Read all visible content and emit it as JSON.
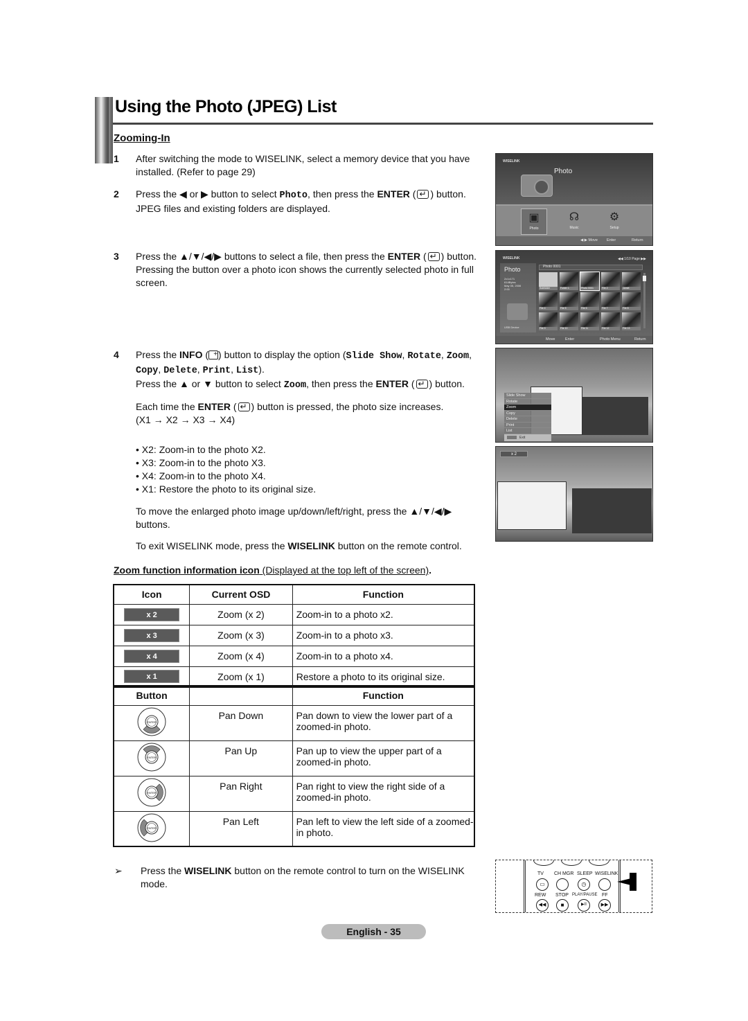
{
  "header": {
    "title": "Using the Photo (JPEG) List",
    "section": "Zooming-In"
  },
  "steps": [
    {
      "num": "1",
      "text": "After switching the mode to WISELINK, select a memory device that you have installed. (Refer to page 29)"
    },
    {
      "num": "2",
      "pre": "Press the ◀ or ▶ button to select ",
      "code": "Photo",
      "mid": ", then press the ",
      "bold": "ENTER",
      "post": " button. JPEG files and existing folders are displayed."
    },
    {
      "num": "3",
      "pre": "Press the ▲/▼/◀/▶ buttons to select a file, then press the ",
      "bold": "ENTER",
      "post": " button.",
      "extra": "Pressing the button over a photo icon shows the currently selected photo in full screen."
    },
    {
      "num": "4",
      "pre": "Press the ",
      "bold": "INFO",
      "mid": " button to display the option (",
      "options": [
        "Slide Show",
        "Rotate",
        "Zoom",
        "Copy",
        "Delete",
        "Print",
        "List"
      ],
      "post": ").",
      "line2_pre": "Press the ▲ or ▼ button to select ",
      "line2_code": "Zoom",
      "line2_mid": ", then press the ",
      "line2_bold": "ENTER",
      "line2_post": " button.",
      "line3_pre": "Each time the ",
      "line3_bold": "ENTER",
      "line3_post": " button is pressed, the photo size increases.",
      "line4": "(X1 → X2 →  X3 → X4)"
    }
  ],
  "bullets": [
    "• X2: Zoom-in to the photo X2.",
    "• X3: Zoom-in to the photo X3.",
    "• X4: Zoom-in to the photo X4.",
    "• X1: Restore the photo to its original size."
  ],
  "move_text": "To move the enlarged photo image up/down/left/right, press the ▲/▼/◀/▶ buttons.",
  "exit_text": {
    "pre": "To exit WISELINK mode, press the ",
    "bold": "WISELINK",
    "post": " button on the remote control."
  },
  "zoom_info": {
    "heading": "Zoom function information icon",
    "sub": " (Displayed at the top left of the screen)",
    "end": "."
  },
  "zoom_table": {
    "headers": [
      "Icon",
      "Current OSD",
      "Function"
    ],
    "rows": [
      {
        "icon": "x 2",
        "osd": "Zoom (x 2)",
        "function": "Zoom-in to a photo x2."
      },
      {
        "icon": "x 3",
        "osd": "Zoom (x 3)",
        "function": "Zoom-in to a photo x3."
      },
      {
        "icon": "x 4",
        "osd": "Zoom (x 4)",
        "function": "Zoom-in to a photo x4."
      },
      {
        "icon": "x 1",
        "osd": "Zoom (x 1)",
        "function": "Restore a photo to its original size."
      }
    ]
  },
  "pan_table": {
    "headers": [
      "Button",
      "",
      "Function"
    ],
    "rows": [
      {
        "highlight": "down",
        "action": "Pan Down",
        "function": "Pan down to view the lower part of a zoomed-in photo."
      },
      {
        "highlight": "up",
        "action": "Pan Up",
        "function": "Pan up to view the upper part of a zoomed-in photo."
      },
      {
        "highlight": "right",
        "action": "Pan Right",
        "function": "Pan right to view the right side of a zoomed-in photo."
      },
      {
        "highlight": "left",
        "action": "Pan Left",
        "function": "Pan left to view the left side of a zoomed-in photo."
      }
    ]
  },
  "note": {
    "arrow": "➢",
    "pre": "Press the ",
    "bold": "WISELINK",
    "post": " button on the remote control to turn on the WISELINK mode."
  },
  "footer": {
    "page": "English - 35"
  },
  "screens": {
    "s1": {
      "logo": "WISELINK",
      "title": "Photo",
      "menu": [
        "Photo",
        "Music",
        "Setup"
      ],
      "footer": [
        "◀ ▶ Move",
        "Enter",
        "Return"
      ]
    },
    "s2": {
      "logo": "WISELINK",
      "page": "◀◀ 1/10 Page ▶▶",
      "title": "Photo",
      "info": [
        "2x1x171",
        "614Bytes",
        "May 05, 2006",
        "2:00"
      ],
      "device": "USB Device",
      "path": "Photo 0001",
      "thumbs": [
        "Subfolder",
        "Folder 1",
        "Photo 0001",
        "File 2",
        "Jamet",
        "File 4",
        "File 5",
        "File 6",
        "File 7",
        "File 8",
        "File 9",
        "File 10",
        "File 11",
        "File 12",
        "File 13"
      ],
      "footer": [
        "Move",
        "Enter",
        "Photo Menu",
        "Return"
      ]
    },
    "s3": {
      "menu": [
        "Slide Show",
        "Rotate",
        "Zoom",
        "Copy",
        "Delete",
        "Print",
        "List"
      ],
      "selected": "Zoom",
      "exit": "Exit"
    },
    "s4": {
      "zoom_osd": "x 2"
    }
  },
  "remote": {
    "labels": [
      "TV",
      "CH MGR",
      "SLEEP",
      "WISELINK",
      "REW",
      "STOP",
      "PLAY/PAUSE",
      "FF"
    ],
    "glyphs": [
      "▭",
      "",
      "◷",
      "",
      "◀◀",
      "■",
      "▶II",
      "▶▶"
    ]
  }
}
